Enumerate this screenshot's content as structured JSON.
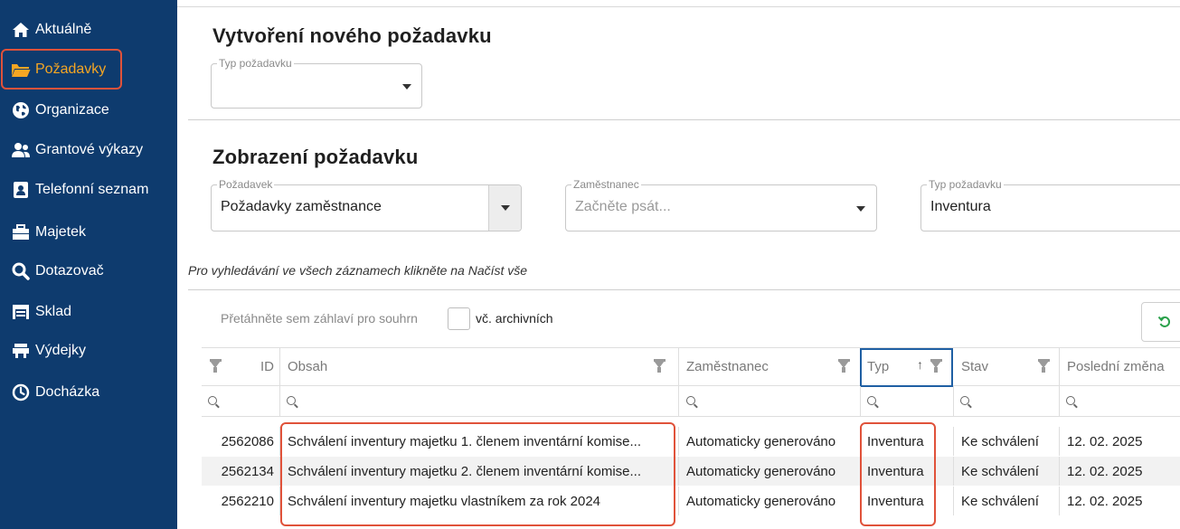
{
  "sidebar": {
    "items": [
      {
        "label": "Aktuálně",
        "icon": "home-icon"
      },
      {
        "label": "Požadavky",
        "icon": "folder-open-icon",
        "active": true
      },
      {
        "label": "Organizace",
        "icon": "globe-icon"
      },
      {
        "label": "Grantové výkazy",
        "icon": "users-icon"
      },
      {
        "label": "Telefonní seznam",
        "icon": "address-card-icon"
      },
      {
        "label": "Majetek",
        "icon": "toolbox-icon"
      },
      {
        "label": "Dotazovač",
        "icon": "search-icon"
      },
      {
        "label": "Sklad",
        "icon": "warehouse-icon"
      },
      {
        "label": "Výdejky",
        "icon": "dispense-icon"
      },
      {
        "label": "Docházka",
        "icon": "clock-icon"
      }
    ]
  },
  "create": {
    "title": "Vytvoření nového požadavku",
    "type_field": {
      "legend": "Typ požadavku",
      "value": ""
    }
  },
  "view": {
    "title": "Zobrazení požadavku",
    "request_field": {
      "legend": "Požadavek",
      "value": "Požadavky zaměstnance"
    },
    "employee_field": {
      "legend": "Zaměstnanec",
      "placeholder": "Začněte psát..."
    },
    "type_field": {
      "legend": "Typ požadavku",
      "value": "Inventura"
    }
  },
  "hint": "Pro vyhledávání ve všech záznamech klikněte na Načíst vše",
  "toolbar": {
    "group_hint": "Přetáhněte sem záhlaví pro souhrn",
    "archive_label": "vč. archivních",
    "archive_checked": false
  },
  "grid": {
    "columns": [
      "ID",
      "Obsah",
      "Zaměstnanec",
      "Typ",
      "Stav",
      "Poslední změna"
    ],
    "sort": {
      "column": "Typ",
      "direction": "asc"
    },
    "rows": [
      {
        "id": "2562086",
        "obsah": "Schválení inventury majetku 1. členem inventární komise...",
        "zamestnanec": "Automaticky generováno",
        "typ": "Inventura",
        "stav": "Ke schválení",
        "zmena": "12. 02. 2025"
      },
      {
        "id": "2562134",
        "obsah": "Schválení inventury majetku 2. členem inventární komise...",
        "zamestnanec": "Automaticky generováno",
        "typ": "Inventura",
        "stav": "Ke schválení",
        "zmena": "12. 02. 2025"
      },
      {
        "id": "2562210",
        "obsah": "Schválení inventury majetku vlastníkem za rok 2024",
        "zamestnanec": "Automaticky generováno",
        "typ": "Inventura",
        "stav": "Ke schválení",
        "zmena": "12. 02. 2025"
      }
    ]
  },
  "colors": {
    "sidebar": "#0e3b6e",
    "active": "#f5a623",
    "highlight": "#e0523a",
    "accent": "#1f5fa3",
    "refresh": "#2aa14b"
  }
}
